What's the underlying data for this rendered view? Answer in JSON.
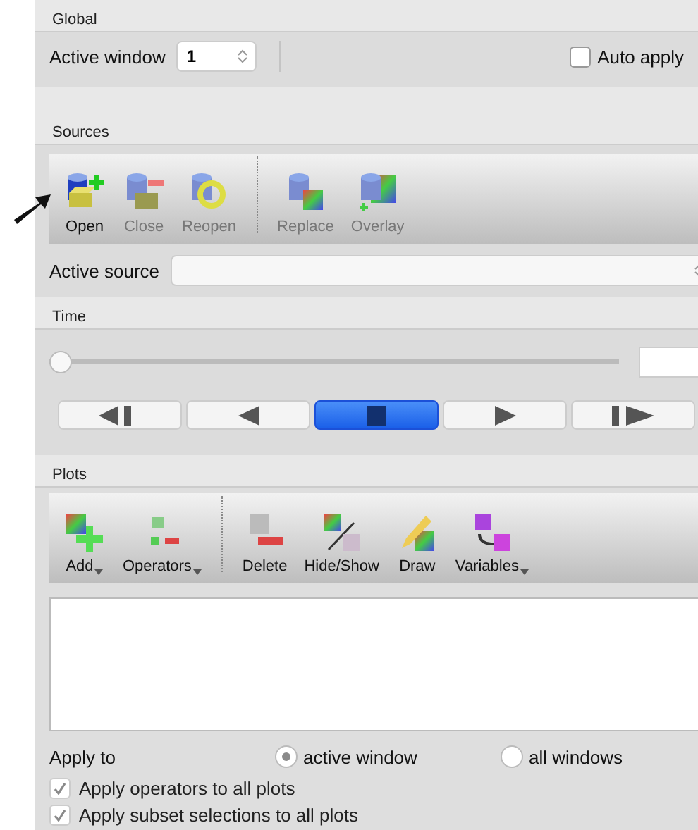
{
  "global": {
    "title": "Global",
    "active_window_label": "Active window",
    "active_window_value": "1",
    "auto_apply": {
      "label": "Auto apply",
      "checked": false
    }
  },
  "sources": {
    "title": "Sources",
    "tools": [
      {
        "label": "Open",
        "kind": "open",
        "disabled": false
      },
      {
        "label": "Close",
        "kind": "close",
        "disabled": true
      },
      {
        "label": "Reopen",
        "kind": "reopen",
        "disabled": true
      },
      {
        "label": "Replace",
        "kind": "replace",
        "disabled": true
      },
      {
        "label": "Overlay",
        "kind": "overlay",
        "disabled": true
      }
    ],
    "active_source_label": "Active source"
  },
  "time": {
    "title": "Time",
    "level": 0,
    "controls": [
      {
        "kind": "first",
        "selected": false
      },
      {
        "kind": "back",
        "selected": false
      },
      {
        "kind": "stop",
        "selected": true
      },
      {
        "kind": "play",
        "selected": false
      },
      {
        "kind": "last",
        "selected": false
      }
    ]
  },
  "plots": {
    "title": "Plots",
    "tools": [
      {
        "label": "Add",
        "kind": "add",
        "dropdown": true
      },
      {
        "label": "Operators",
        "kind": "operators",
        "dropdown": true
      },
      {
        "label": "Delete",
        "kind": "delete",
        "dropdown": false
      },
      {
        "label": "Hide/Show",
        "kind": "hide",
        "dropdown": false
      },
      {
        "label": "Draw",
        "kind": "draw",
        "dropdown": false
      },
      {
        "label": "Variables",
        "kind": "variables",
        "dropdown": true
      }
    ],
    "apply_to_label": "Apply to",
    "apply_to": [
      {
        "label": "active window",
        "selected": true
      },
      {
        "label": "all windows",
        "selected": false
      }
    ],
    "options": [
      {
        "label": "Apply operators to all plots",
        "checked": true,
        "disabled": true
      },
      {
        "label": "Apply subset selections to all plots",
        "checked": true,
        "disabled": true
      }
    ]
  }
}
